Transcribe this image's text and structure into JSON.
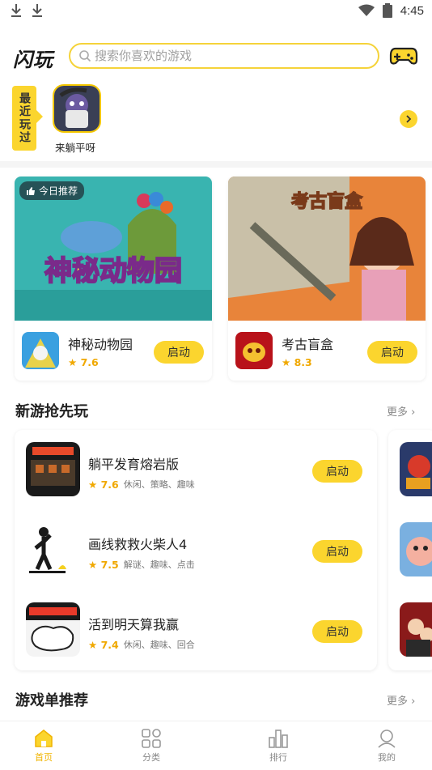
{
  "status_bar": {
    "time": "4:45"
  },
  "header": {
    "logo": "闪玩",
    "search_placeholder": "搜索你喜欢的游戏"
  },
  "recent": {
    "tag": "最近玩过",
    "games": [
      {
        "name": "来躺平呀"
      }
    ]
  },
  "featured": [
    {
      "badge": "今日推荐",
      "banner_title": "神秘动物园",
      "name": "神秘动物园",
      "rating": "7.6",
      "button": "启动"
    },
    {
      "banner_title": "考古盲盒",
      "name": "考古盲盒",
      "rating": "8.3",
      "button": "启动"
    }
  ],
  "new_games": {
    "title": "新游抢先玩",
    "more": "更多",
    "items": [
      {
        "name": "躺平发育熔岩版",
        "rating": "7.6",
        "tags": "休闲、策略、趣味",
        "button": "启动"
      },
      {
        "name": "画线救救火柴人4",
        "rating": "7.5",
        "tags": "解谜、趣味、点击",
        "button": "启动"
      },
      {
        "name": "活到明天算我赢",
        "rating": "7.4",
        "tags": "休闲、趣味、回合",
        "button": "启动"
      }
    ]
  },
  "playlist": {
    "title": "游戏单推荐",
    "more": "更多"
  },
  "bottom_nav": [
    {
      "label": "首页",
      "icon": "home-icon",
      "active": true
    },
    {
      "label": "分类",
      "icon": "grid-icon"
    },
    {
      "label": "排行",
      "icon": "ranking-icon"
    },
    {
      "label": "我的",
      "icon": "profile-icon"
    }
  ],
  "colors": {
    "accent": "#fbd52e",
    "rating": "#f0a800"
  }
}
